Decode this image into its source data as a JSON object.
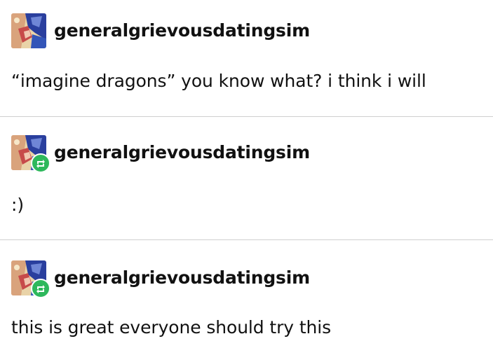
{
  "posts": [
    {
      "username": "generalgrievousdatingsim",
      "is_reblog": false,
      "text": "“imagine dragons” you know what? i think i will"
    },
    {
      "username": "generalgrievousdatingsim",
      "is_reblog": true,
      "text": ":)"
    },
    {
      "username": "generalgrievousdatingsim",
      "is_reblog": true,
      "text": "this is great everyone should try this"
    }
  ],
  "colors": {
    "reblog_badge": "#2eb85c",
    "divider": "#cfcfcf",
    "text": "#111111"
  },
  "icons": {
    "avatar": "avatar-icon",
    "reblog": "reblog-icon"
  }
}
